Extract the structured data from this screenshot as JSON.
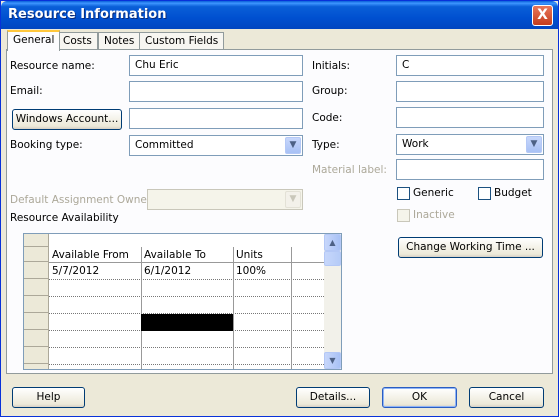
{
  "window": {
    "title": "Resource Information",
    "close_glyph": "X"
  },
  "tabs": [
    {
      "label": "General",
      "active": true
    },
    {
      "label": "Costs",
      "active": false
    },
    {
      "label": "Notes",
      "active": false
    },
    {
      "label": "Custom Fields",
      "active": false
    }
  ],
  "form": {
    "resource_name_label": "Resource name:",
    "resource_name_value": "Chu Eric",
    "email_label": "Email:",
    "email_value": "",
    "windows_account_label": "Windows Account...",
    "windows_account_value": "",
    "booking_type_label": "Booking type:",
    "booking_type_value": "Committed",
    "default_owner_label": "Default Assignment Owner:",
    "default_owner_value": "",
    "initials_label": "Initials:",
    "initials_value": "C",
    "group_label": "Group:",
    "group_value": "",
    "code_label": "Code:",
    "code_value": "",
    "type_label": "Type:",
    "type_value": "Work",
    "material_label_label": "Material label:",
    "material_label_value": "",
    "generic_label": "Generic",
    "budget_label": "Budget",
    "inactive_label": "Inactive"
  },
  "availability": {
    "section_label": "Resource Availability",
    "columns": [
      "Available From",
      "Available To",
      "Units"
    ],
    "rows": [
      [
        "5/7/2012",
        "6/1/2012",
        "100%"
      ],
      [
        "",
        "",
        ""
      ],
      [
        "",
        "",
        ""
      ],
      [
        "",
        "",
        ""
      ],
      [
        "",
        "",
        ""
      ],
      [
        "",
        "",
        ""
      ]
    ]
  },
  "buttons": {
    "change_working_time": "Change Working Time ...",
    "help": "Help",
    "details": "Details...",
    "ok": "OK",
    "cancel": "Cancel"
  },
  "icons": {
    "dropdown": "chevron-down-icon",
    "scroll_up": "arrow-up-icon",
    "scroll_down": "arrow-down-icon"
  }
}
